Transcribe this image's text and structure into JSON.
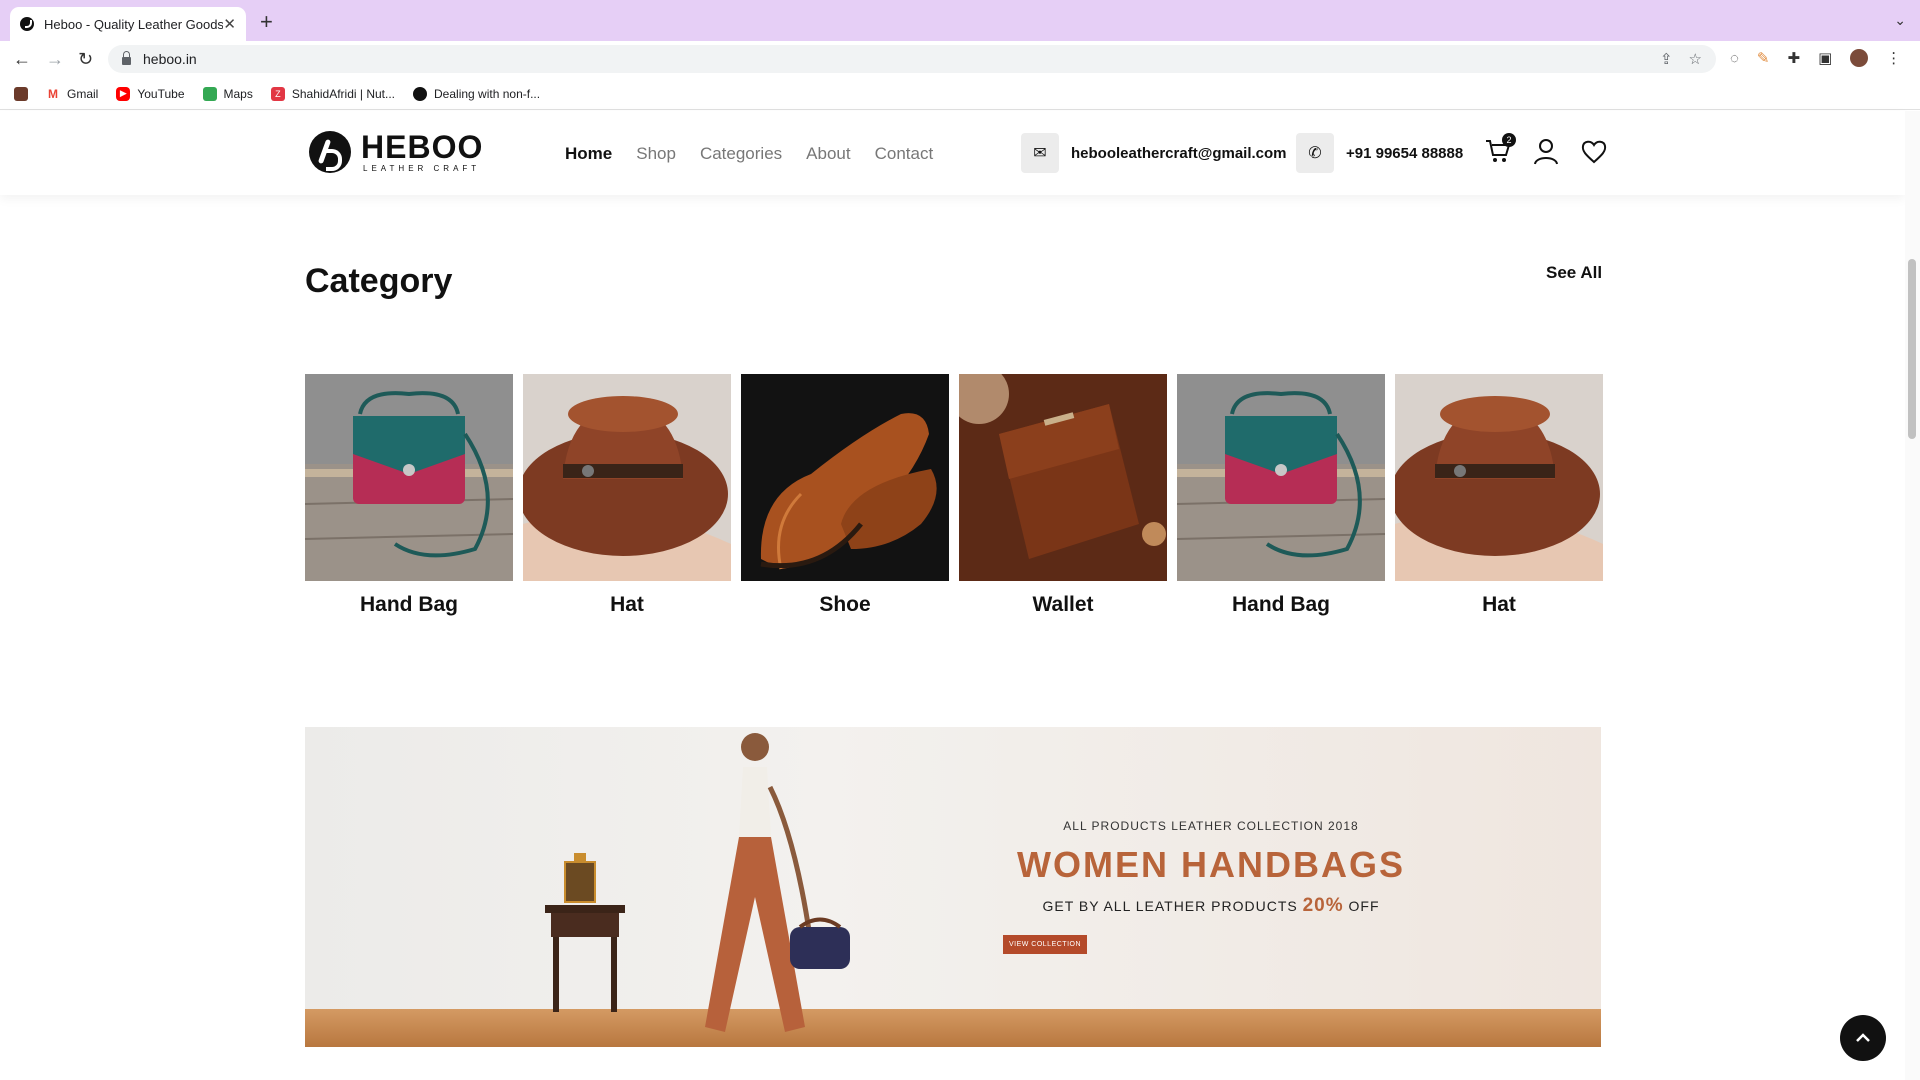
{
  "browser": {
    "tab_title": "Heboo - Quality Leather Goods",
    "tab_close": "✕",
    "new_tab": "+",
    "url": "heboo.in",
    "bookmarks": [
      {
        "label": "",
        "icon": "bookmark-app-icon",
        "color": "#6b3a2a"
      },
      {
        "label": "Gmail",
        "icon": "gmail-icon",
        "color": "#ea4335"
      },
      {
        "label": "YouTube",
        "icon": "youtube-icon",
        "color": "#ff0000"
      },
      {
        "label": "Maps",
        "icon": "maps-icon",
        "color": "#34a853"
      },
      {
        "label": "ShahidAfridi | Nut...",
        "icon": "zomato-icon",
        "color": "#e23744"
      },
      {
        "label": "Dealing with non-f...",
        "icon": "github-icon",
        "color": "#111111"
      }
    ]
  },
  "header": {
    "logo_name": "HEBOO",
    "logo_tagline": "LEATHER CRAFT",
    "nav": [
      "Home",
      "Shop",
      "Categories",
      "About",
      "Contact"
    ],
    "active_nav": "Home",
    "email": "hebooleathercraft@gmail.com",
    "phone": "+91 99654 88888",
    "cart_count": "2"
  },
  "category": {
    "title": "Category",
    "see_all": "See All",
    "items": [
      {
        "label": "Hand Bag"
      },
      {
        "label": "Hat"
      },
      {
        "label": "Shoe"
      },
      {
        "label": "Wallet"
      },
      {
        "label": "Hand Bag"
      },
      {
        "label": "Hat"
      }
    ]
  },
  "banner": {
    "subtitle": "ALL PRODUCTS LEATHER COLLECTION 2018",
    "title": "WOMEN HANDBAGS",
    "offer_prefix": "GET BY ALL LEATHER PRODUCTS",
    "offer_pct": "20%",
    "offer_suffix": "OFF",
    "button": "VIEW COLLECTION"
  },
  "colors": {
    "accent": "#b8643a",
    "browser_frame": "#e6cff6"
  }
}
